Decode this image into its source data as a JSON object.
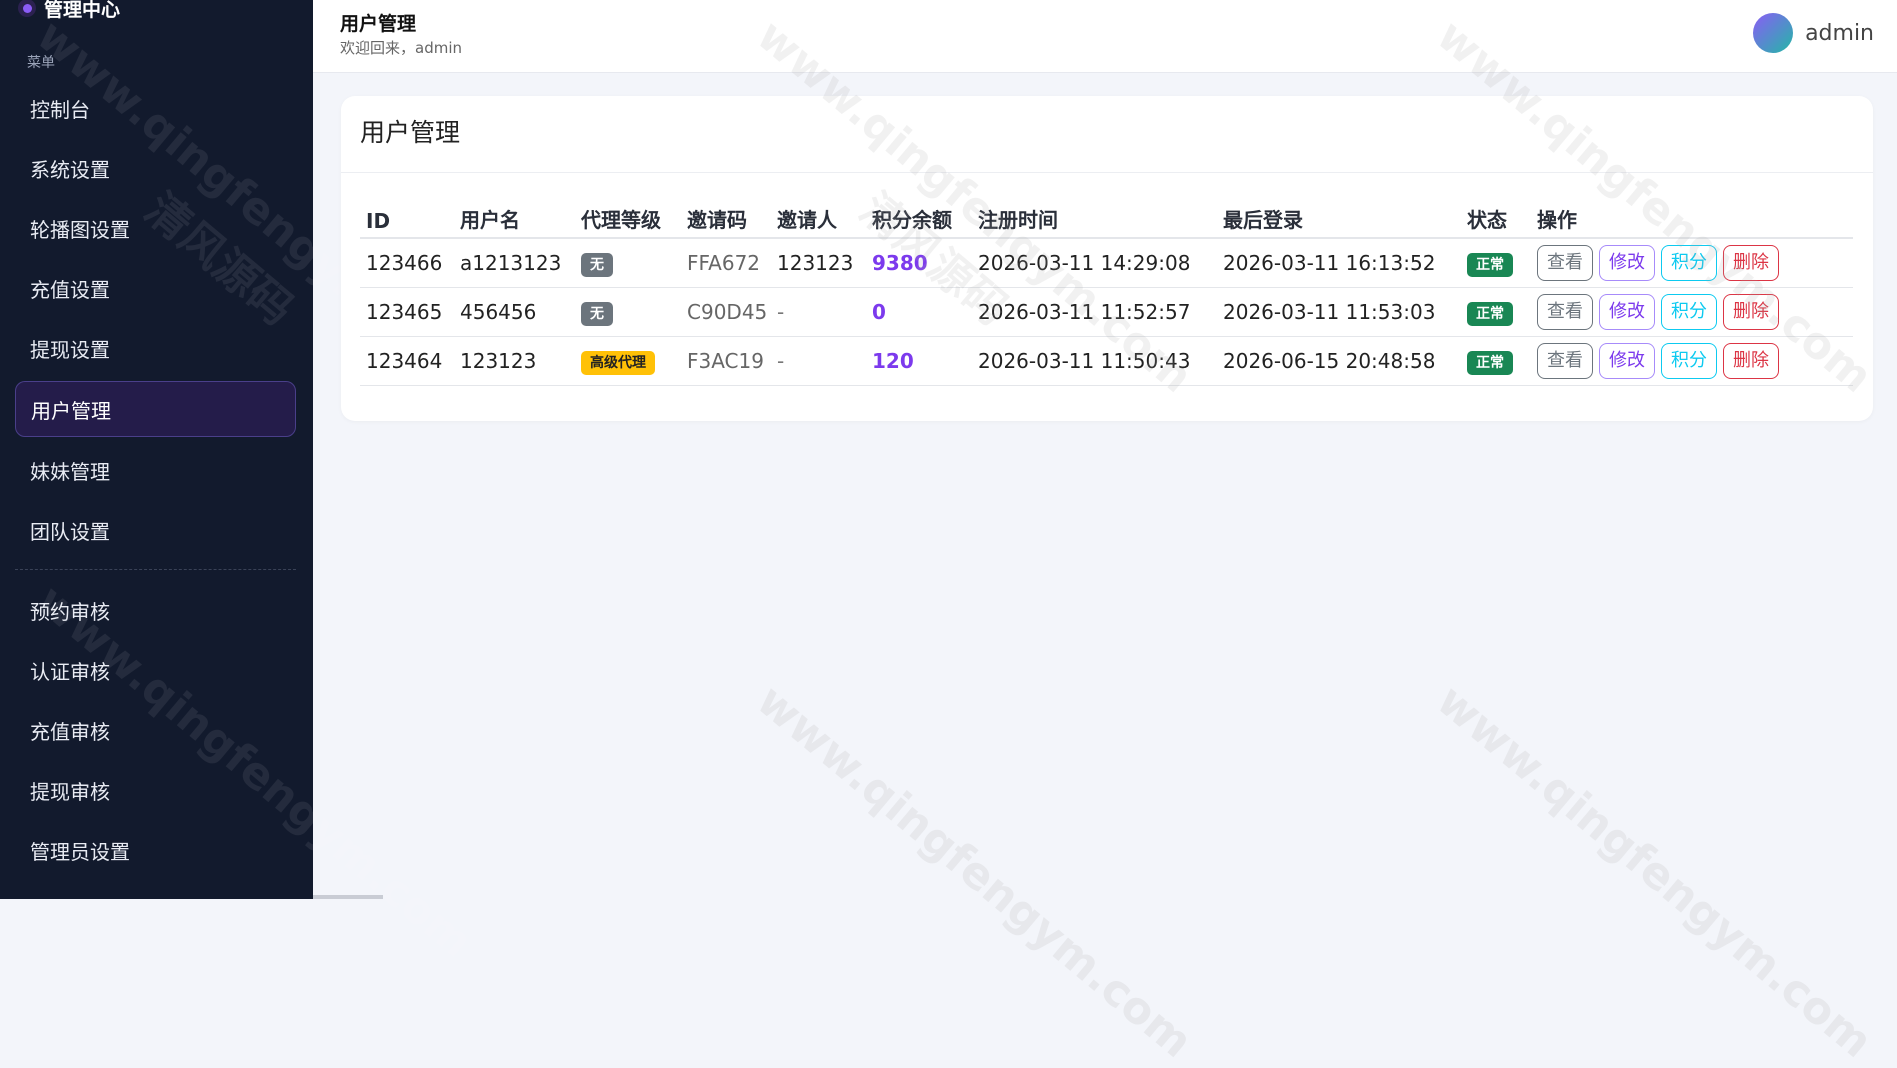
{
  "sidebar": {
    "brand": "管理中心",
    "caption": "菜单",
    "items": [
      {
        "label": "控制台"
      },
      {
        "label": "系统设置"
      },
      {
        "label": "轮播图设置"
      },
      {
        "label": "充值设置"
      },
      {
        "label": "提现设置"
      },
      {
        "label": "用户管理"
      },
      {
        "label": "妹妹管理"
      },
      {
        "label": "团队设置"
      },
      {
        "label": "预约审核"
      },
      {
        "label": "认证审核"
      },
      {
        "label": "充值审核"
      },
      {
        "label": "提现审核"
      },
      {
        "label": "管理员设置"
      }
    ]
  },
  "header": {
    "title": "用户管理",
    "subtitle": "欢迎回来，admin",
    "username": "admin"
  },
  "card": {
    "title": "用户管理",
    "columns": [
      "ID",
      "用户名",
      "代理等级",
      "邀请码",
      "邀请人",
      "积分余额",
      "注册时间",
      "最后登录",
      "状态",
      "操作"
    ],
    "rows": [
      {
        "id": "123466",
        "username": "a1213123",
        "level": "无",
        "invite_code": "FFA672",
        "inviter": "123123",
        "points": "9380",
        "registered": "2026-03-11 14:29:08",
        "last_login": "2026-03-11 16:13:52",
        "status": "正常"
      },
      {
        "id": "123465",
        "username": "456456",
        "level": "无",
        "invite_code": "C90D45",
        "inviter": "-",
        "points": "0",
        "registered": "2026-03-11 11:52:57",
        "last_login": "2026-03-11 11:53:03",
        "status": "正常"
      },
      {
        "id": "123464",
        "username": "123123",
        "level": "高级代理",
        "invite_code": "F3AC19",
        "inviter": "-",
        "points": "120",
        "registered": "2026-03-11 11:50:43",
        "last_login": "2026-06-15 20:48:58",
        "status": "正常"
      }
    ],
    "actions": {
      "view": "查看",
      "edit": "修改",
      "points": "积分",
      "delete": "删除"
    }
  },
  "watermark": {
    "url": "www.qingfengym.com",
    "name": "清风源码"
  },
  "colors": {
    "sidebar_bg": "#121a2d",
    "accent": "#7c3aed",
    "status_ok": "#198754",
    "level_none": "#6c757d",
    "level_senior": "#ffc107"
  }
}
